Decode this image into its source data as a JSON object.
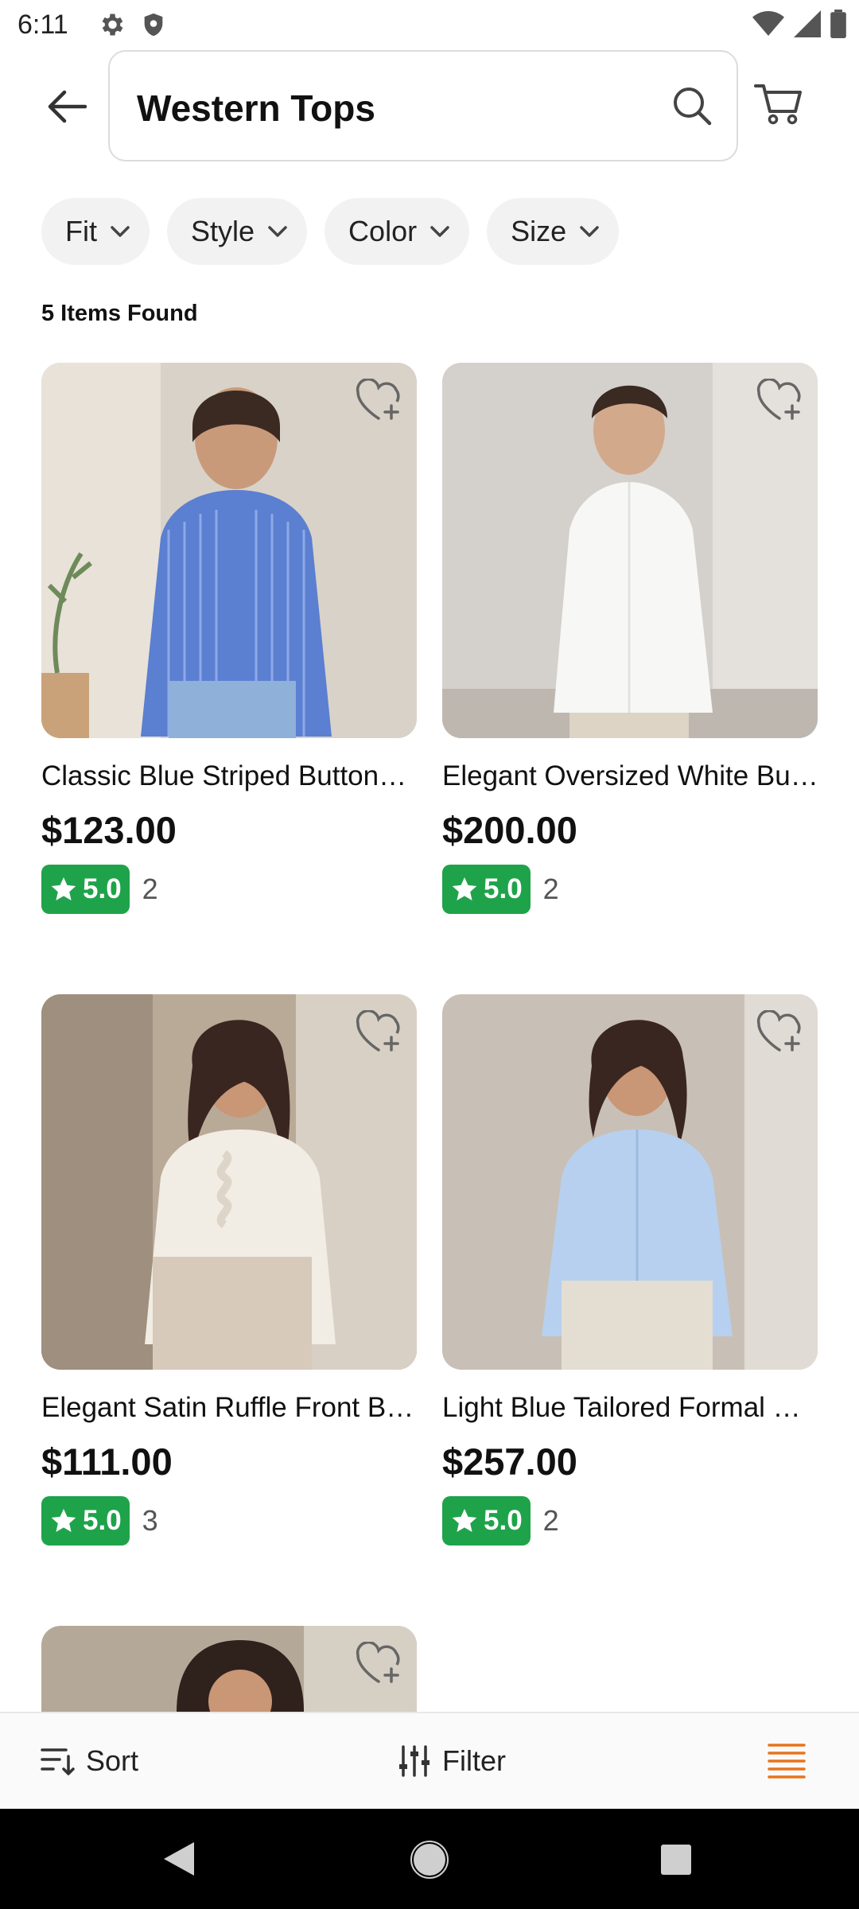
{
  "status_bar": {
    "time": "6:11",
    "left_icons": [
      "gear-icon",
      "shield-icon"
    ],
    "right_icons": [
      "wifi-icon",
      "signal-icon",
      "battery-icon"
    ]
  },
  "header": {
    "search_query": "Western Tops"
  },
  "filters": [
    {
      "label": "Fit"
    },
    {
      "label": "Style"
    },
    {
      "label": "Color"
    },
    {
      "label": "Size"
    }
  ],
  "results_count": "5 Items Found",
  "products": [
    {
      "title": "Classic Blue Striped Button…",
      "price": "$123.00",
      "rating": "5.0",
      "reviews": "2"
    },
    {
      "title": "Elegant Oversized White Bu…",
      "price": "$200.00",
      "rating": "5.0",
      "reviews": "2"
    },
    {
      "title": "Elegant Satin Ruffle Front B…",
      "price": "$111.00",
      "rating": "5.0",
      "reviews": "3"
    },
    {
      "title": "Light Blue Tailored Formal …",
      "price": "$257.00",
      "rating": "5.0",
      "reviews": "2"
    }
  ],
  "bottom_bar": {
    "sort_label": "Sort",
    "filter_label": "Filter"
  },
  "colors": {
    "rating_green": "#1fa34a",
    "accent_orange": "#e8741c"
  }
}
